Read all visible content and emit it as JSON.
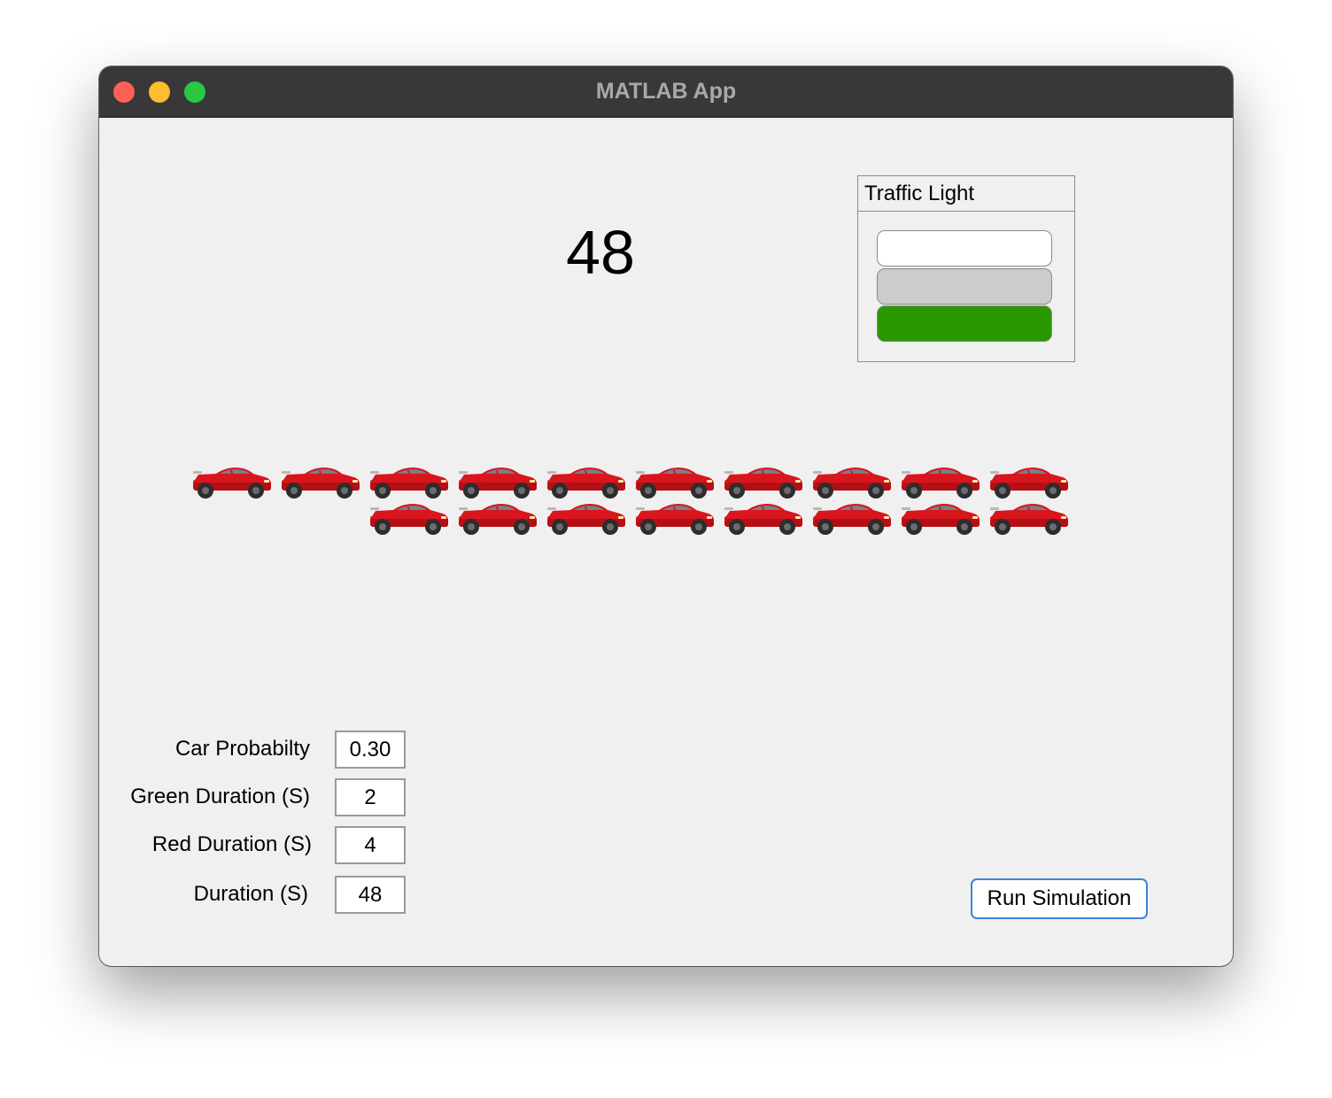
{
  "window": {
    "title": "MATLAB App"
  },
  "counter": {
    "value": "48"
  },
  "traffic_light": {
    "title": "Traffic Light",
    "lamps": [
      {
        "name": "red",
        "color": "#ffffff"
      },
      {
        "name": "yellow",
        "color": "#cccccc"
      },
      {
        "name": "green",
        "color": "#2a9800"
      }
    ],
    "active": "green"
  },
  "cars": {
    "icon": "red-sports-car-icon",
    "body_color": "#d9151e",
    "rows": [
      10,
      8
    ]
  },
  "params": [
    {
      "label": "Car Probabilty",
      "value": "0.30"
    },
    {
      "label": "Green Duration (S)",
      "value": "2"
    },
    {
      "label": "Red Duration (S)",
      "value": "4"
    },
    {
      "label": "Duration (S)",
      "value": "48"
    }
  ],
  "run_button": {
    "label": "Run Simulation"
  }
}
